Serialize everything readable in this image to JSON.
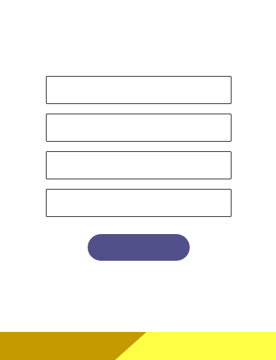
{
  "form": {
    "fields": [
      {
        "value": "",
        "placeholder": ""
      },
      {
        "value": "",
        "placeholder": ""
      },
      {
        "value": "",
        "placeholder": ""
      },
      {
        "value": "",
        "placeholder": ""
      }
    ],
    "submit_label": ""
  },
  "colors": {
    "button": "#52508a",
    "footer_dark": "#c49a00",
    "footer_light": "#ffff44",
    "field_border": "#1a1a1a"
  }
}
